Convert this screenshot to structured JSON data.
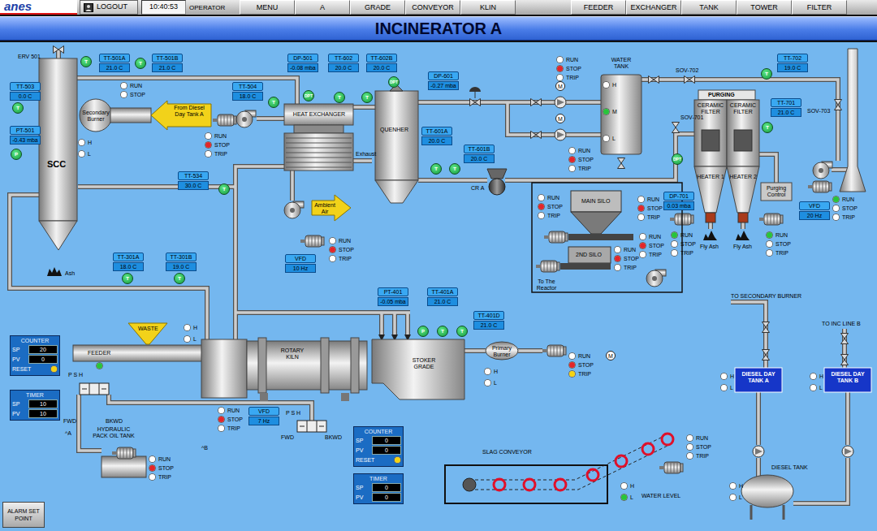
{
  "top_bar": {
    "logo": "anes",
    "logout": "LOGOUT",
    "time": "10:40:53",
    "user": "OPERATOR",
    "menu": [
      {
        "label": "MENU",
        "selected": false
      },
      {
        "label": "A",
        "selected": false
      },
      {
        "label": "GRADE",
        "selected": false
      },
      {
        "label": "CONVEYOR",
        "selected": false
      },
      {
        "label": "KLIN",
        "selected": false
      },
      {
        "label": "FEEDER",
        "selected": false
      },
      {
        "label": "EXCHANGER",
        "selected": false
      },
      {
        "label": "TANK",
        "selected": false
      },
      {
        "label": "TOWER",
        "selected": false
      },
      {
        "label": "FILTER",
        "selected": false
      }
    ]
  },
  "title": "INCINERATOR A",
  "tags": [
    {
      "name": "TT-503",
      "value": "0.0 C"
    },
    {
      "name": "PT-501",
      "value": "-0.43 mba"
    },
    {
      "name": "TT-501A",
      "value": "21.0 C"
    },
    {
      "name": "TT-501B",
      "value": "21.0 C"
    },
    {
      "name": "TT-504",
      "value": "18.0 C"
    },
    {
      "name": "DP-501",
      "value": "-0.08 mba"
    },
    {
      "name": "TT-602",
      "value": "20.0 C"
    },
    {
      "name": "TT-602B",
      "value": "20.0 C"
    },
    {
      "name": "DP-601",
      "value": "-0.27 mba"
    },
    {
      "name": "TT-601A",
      "value": "20.0 C"
    },
    {
      "name": "TT-601B",
      "value": "20.0 C"
    },
    {
      "name": "TT-534",
      "value": "30.0 C"
    },
    {
      "name": "TT-301A",
      "value": "18.0 C"
    },
    {
      "name": "TT-301B",
      "value": "19.0 C"
    },
    {
      "name": "PT-401",
      "value": "-0.05 mba"
    },
    {
      "name": "TT-401A",
      "value": "21.0 C"
    },
    {
      "name": "TT-401D",
      "value": "21.0 C"
    },
    {
      "name": "DP-701",
      "value": "0.03 mba"
    },
    {
      "name": "TT-702",
      "value": "19.0 C"
    },
    {
      "name": "TT-701",
      "value": "21.0 C"
    },
    {
      "name": "VFD",
      "value": "10 Hz"
    },
    {
      "name": "VFD",
      "value": "7 Hz"
    },
    {
      "name": "VFD",
      "value": "20 Hz"
    }
  ],
  "gauges": [
    "T",
    "P",
    "T",
    "T",
    "T",
    "DPT",
    "T",
    "T",
    "DPT",
    "T",
    "T",
    "T",
    "T",
    "T",
    "P",
    "T",
    "T",
    "T",
    "T",
    "DPT"
  ],
  "motor_marks": [
    "M",
    "M",
    "M"
  ],
  "labels": [
    {
      "text": "ERV 501",
      "kind": "plain"
    },
    {
      "text": "SCC",
      "kind": "bold"
    },
    {
      "text": "Secondary Burner",
      "kind": "plain"
    },
    {
      "text": "From Diesel Day Tank A",
      "kind": "plain"
    },
    {
      "text": "HEAT EXCHANGER",
      "kind": "plain"
    },
    {
      "text": "Exhaust",
      "kind": "plain"
    },
    {
      "text": "Ambient Air",
      "kind": "plain"
    },
    {
      "text": "QUENHER",
      "kind": "plain"
    },
    {
      "text": "CR A",
      "kind": "plain"
    },
    {
      "text": "WATER TANK",
      "kind": "plain"
    },
    {
      "text": "SOV-702",
      "kind": "plain"
    },
    {
      "text": "SOV-701",
      "kind": "plain"
    },
    {
      "text": "SOV-703",
      "kind": "plain"
    },
    {
      "text": "PURGING",
      "kind": "head"
    },
    {
      "text": "CERAMIC FILTER",
      "kind": "plain"
    },
    {
      "text": "CERAMIC FILTER",
      "kind": "plain"
    },
    {
      "text": "HEATER 1",
      "kind": "plain"
    },
    {
      "text": "HEATER 2",
      "kind": "plain"
    },
    {
      "text": "Purging Control",
      "kind": "plain"
    },
    {
      "text": "Fly Ash",
      "kind": "plain"
    },
    {
      "text": "Fly Ash",
      "kind": "plain"
    },
    {
      "text": "MAIN SILO",
      "kind": "plain"
    },
    {
      "text": "2ND SILO",
      "kind": "plain"
    },
    {
      "text": "To The Reactor",
      "kind": "plain"
    },
    {
      "text": "Ash",
      "kind": "plain"
    },
    {
      "text": "WASTE",
      "kind": "plain"
    },
    {
      "text": "FEEDER",
      "kind": "plain"
    },
    {
      "text": "ROTARY KILN",
      "kind": "plain"
    },
    {
      "text": "STOKER GRADE",
      "kind": "plain"
    },
    {
      "text": "Primary Burner",
      "kind": "plain"
    },
    {
      "text": "HYDRAULIC PACK OIL TANK",
      "kind": "plain"
    },
    {
      "text": "FWD",
      "kind": "plain"
    },
    {
      "text": "BKWD",
      "kind": "plain"
    },
    {
      "text": "FWD",
      "kind": "plain"
    },
    {
      "text": "BKWD",
      "kind": "plain"
    },
    {
      "text": "^A",
      "kind": "plain"
    },
    {
      "text": "^B",
      "kind": "plain"
    },
    {
      "text": "P S H",
      "kind": "plain"
    },
    {
      "text": "P S H",
      "kind": "plain"
    },
    {
      "text": "TO SECONDARY BURNER",
      "kind": "plain"
    },
    {
      "text": "TO INC LINE B",
      "kind": "plain"
    },
    {
      "text": "DIESEL DAY TANK A",
      "kind": "light"
    },
    {
      "text": "DIESEL DAY TANK B",
      "kind": "light"
    },
    {
      "text": "DIESEL TANK",
      "kind": "plain"
    },
    {
      "text": "SLAG CONVEYOR",
      "kind": "plain"
    },
    {
      "text": "WATER LEVEL",
      "kind": "plain"
    }
  ],
  "motors": [
    {
      "lamps": [
        {
          "label": "RUN",
          "on": false
        },
        {
          "label": "STOP",
          "on": false
        }
      ]
    },
    {
      "lamps": [
        {
          "label": "RUN",
          "on": false
        },
        {
          "label": "STOP",
          "on": true,
          "color": "#e3262a"
        },
        {
          "label": "TRIP",
          "on": false
        }
      ]
    },
    {
      "lamps": [
        {
          "label": "RUN",
          "on": false
        },
        {
          "label": "STOP",
          "on": true,
          "color": "#e3262a"
        },
        {
          "label": "TRIP",
          "on": false
        }
      ]
    },
    {
      "lamps": [
        {
          "label": "RUN",
          "on": false
        },
        {
          "label": "STOP",
          "on": true,
          "color": "#e3262a"
        },
        {
          "label": "TRIP",
          "on": false
        }
      ]
    },
    {
      "lamps": [
        {
          "label": "RUN",
          "on": false
        },
        {
          "label": "STOP",
          "on": true,
          "color": "#e3262a"
        },
        {
          "label": "TRIP",
          "on": false
        }
      ]
    },
    {
      "lamps": [
        {
          "label": "RUN",
          "on": false
        },
        {
          "label": "STOP",
          "on": true,
          "color": "#e3262a"
        },
        {
          "label": "TRIP",
          "on": false
        }
      ]
    },
    {
      "lamps": [
        {
          "label": "RUN",
          "on": false
        },
        {
          "label": "STOP",
          "on": true,
          "color": "#e3262a"
        },
        {
          "label": "TRIP",
          "on": false
        }
      ]
    },
    {
      "lamps": [
        {
          "label": "RUN",
          "on": false
        },
        {
          "label": "STOP",
          "on": true,
          "color": "#e3262a"
        },
        {
          "label": "TRIP",
          "on": false
        }
      ]
    },
    {
      "lamps": [
        {
          "label": "RUN",
          "on": false
        },
        {
          "label": "STOP",
          "on": true,
          "color": "#e3262a"
        },
        {
          "label": "TRIP",
          "on": false
        }
      ]
    },
    {
      "lamps": [
        {
          "label": "RUN",
          "on": true,
          "color": "#27c43a"
        },
        {
          "label": "STOP",
          "on": false
        },
        {
          "label": "TRIP",
          "on": false
        }
      ]
    },
    {
      "lamps": [
        {
          "label": "RUN",
          "on": true,
          "color": "#27c43a"
        },
        {
          "label": "STOP",
          "on": false
        },
        {
          "label": "TRIP",
          "on": false
        }
      ]
    },
    {
      "lamps": [
        {
          "label": "RUN",
          "on": true,
          "color": "#27c43a"
        },
        {
          "label": "STOP",
          "on": false
        },
        {
          "label": "TRIP",
          "on": false
        }
      ]
    },
    {
      "lamps": [
        {
          "label": "RUN",
          "on": false
        },
        {
          "label": "STOP",
          "on": true,
          "color": "#e3262a"
        },
        {
          "label": "TRIP",
          "on": false
        }
      ]
    },
    {
      "lamps": [
        {
          "label": "RUN",
          "on": false
        },
        {
          "label": "STOP",
          "on": true,
          "color": "#e3262a"
        },
        {
          "label": "TRIP",
          "on": true,
          "color": "#f4d312"
        }
      ]
    },
    {
      "lamps": [
        {
          "label": "RUN",
          "on": false
        },
        {
          "label": "STOP",
          "on": true,
          "color": "#e3262a"
        },
        {
          "label": "TRIP",
          "on": false
        }
      ]
    },
    {
      "lamps": [
        {
          "label": "RUN",
          "on": false
        },
        {
          "label": "STOP",
          "on": false
        },
        {
          "label": "TRIP",
          "on": false
        }
      ]
    }
  ],
  "levels": [
    {
      "items": [
        {
          "label": "H",
          "on": false
        },
        {
          "label": "L",
          "on": false
        }
      ]
    },
    {
      "items": [
        {
          "label": "H",
          "on": false
        },
        {
          "label": "L",
          "on": false
        }
      ]
    },
    {
      "items": [
        {
          "label": "H",
          "on": false
        },
        {
          "label": "L",
          "on": false
        }
      ]
    },
    {
      "items": [
        {
          "label": "H",
          "on": false
        },
        {
          "label": "M",
          "on": true,
          "color": "#27c43a"
        },
        {
          "label": "L",
          "on": false
        }
      ]
    },
    {
      "items": [
        {
          "label": "H",
          "on": false
        },
        {
          "label": "L",
          "on": false
        }
      ]
    },
    {
      "items": [
        {
          "label": "H",
          "on": false
        },
        {
          "label": "L",
          "on": false
        }
      ]
    },
    {
      "items": [
        {
          "label": "H",
          "on": false
        },
        {
          "label": "L",
          "on": false
        }
      ]
    },
    {
      "items": [
        {
          "label": "H",
          "on": false
        },
        {
          "label": "L",
          "on": true,
          "color": "#27c43a"
        }
      ]
    }
  ],
  "indicators": [
    {
      "on": true,
      "color": "#27c43a"
    }
  ],
  "panels": [
    {
      "title": "COUNTER",
      "rows": [
        {
          "label": "SP",
          "value": "20"
        },
        {
          "label": "PV",
          "value": "0"
        }
      ],
      "reset": "RESET",
      "reset_lamp": {
        "on": true,
        "color": "#f4d312"
      }
    },
    {
      "title": "TIMER",
      "rows": [
        {
          "label": "SP",
          "value": "10"
        },
        {
          "label": "PV",
          "value": "10"
        }
      ]
    },
    {
      "title": "COUNTER",
      "rows": [
        {
          "label": "SP",
          "value": "0"
        },
        {
          "label": "PV",
          "value": "0"
        }
      ],
      "reset": "RESET",
      "reset_lamp": {
        "on": true,
        "color": "#f4d312"
      }
    },
    {
      "title": "TIMER",
      "rows": [
        {
          "label": "SP",
          "value": "0"
        },
        {
          "label": "PV",
          "value": "0"
        }
      ]
    }
  ],
  "alarm_button": "ALARM SET POINT"
}
